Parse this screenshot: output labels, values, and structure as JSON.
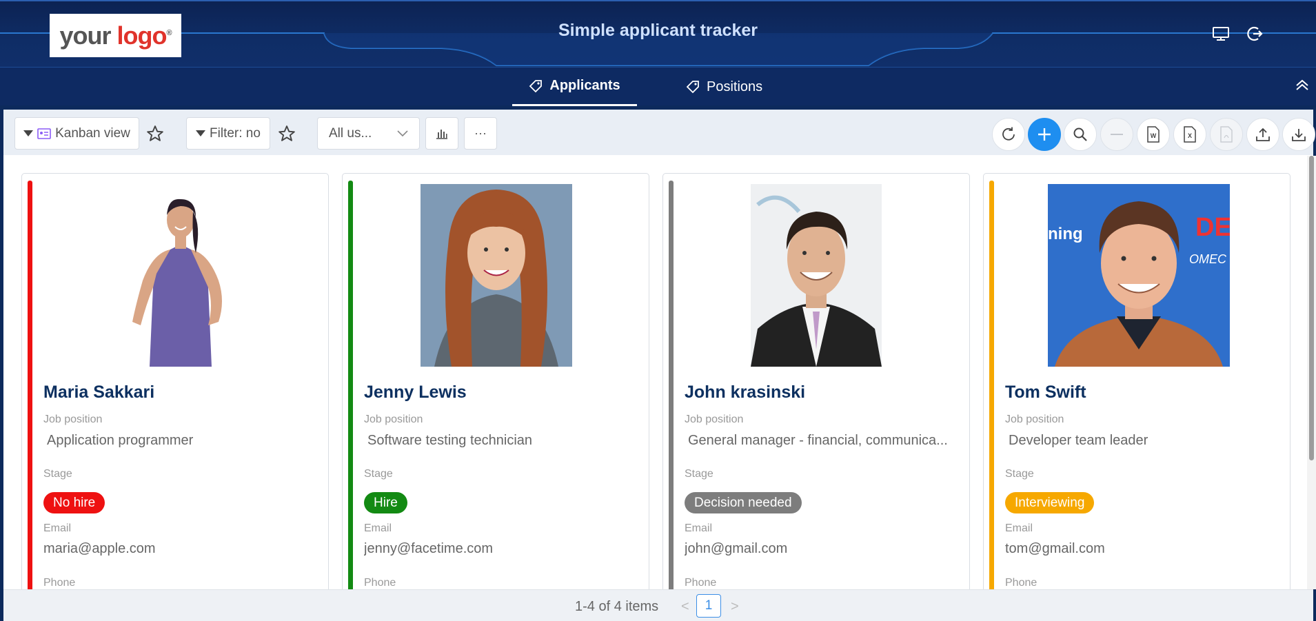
{
  "header": {
    "logo": {
      "part1": "your",
      "part2": "logo",
      "mark": "®"
    },
    "title": "Simple applicant tracker",
    "icons": [
      "monitor-icon",
      "logout-icon"
    ]
  },
  "tabs": [
    {
      "label": "Applicants",
      "icon": "tag-icon",
      "active": true
    },
    {
      "label": "Positions",
      "icon": "tag-icon",
      "active": false
    }
  ],
  "toolbar": {
    "view_label": "Kanban view",
    "filter_label": "Filter: no",
    "user_select": "All us...",
    "more_label": "···"
  },
  "field_labels": {
    "job": "Job position",
    "stage": "Stage",
    "email": "Email",
    "phone": "Phone"
  },
  "cards": [
    {
      "name": "Maria Sakkari",
      "job": "Application programmer",
      "stage": "No hire",
      "stage_color": "#ee1111",
      "email": "maria@apple.com"
    },
    {
      "name": "Jenny Lewis",
      "job": "Software testing technician",
      "stage": "Hire",
      "stage_color": "#138a13",
      "email": "jenny@facetime.com"
    },
    {
      "name": "John krasinski",
      "job": "General manager - financial, communica...",
      "stage": "Decision needed",
      "stage_color": "#7d7d7d",
      "email": "john@gmail.com"
    },
    {
      "name": "Tom Swift",
      "job": "Developer team leader",
      "stage": "Interviewing",
      "stage_color": "#f6a800",
      "email": "tom@gmail.com"
    }
  ],
  "pager": {
    "summary": "1-4 of 4 items",
    "page": "1",
    "prev": "<",
    "next": ">"
  },
  "colors": {
    "header_bg": "#0f2d66",
    "accent": "#1e8ef0",
    "name": "#0d3060"
  }
}
